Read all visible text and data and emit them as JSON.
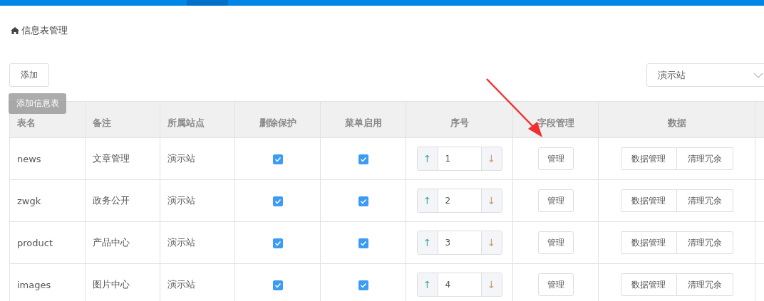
{
  "breadcrumb": {
    "title": "信息表管理"
  },
  "toolbar": {
    "add_button": "添加",
    "tooltip": "添加信息表",
    "site_select": {
      "value": "演示站"
    }
  },
  "table": {
    "columns": [
      "表名",
      "备注",
      "所属站点",
      "删除保护",
      "菜单启用",
      "序号",
      "字段管理",
      "数据"
    ],
    "rows": [
      {
        "name": "news",
        "note": "文章管理",
        "site": "演示站",
        "delete_protect": true,
        "menu_enabled": true,
        "order": "1",
        "up": "↑",
        "down": "↓",
        "field_button": "管理",
        "data_buttons": [
          "数据管理",
          "清理冗余"
        ]
      },
      {
        "name": "zwgk",
        "note": "政务公开",
        "site": "演示站",
        "delete_protect": true,
        "menu_enabled": true,
        "order": "2",
        "up": "↑",
        "down": "↓",
        "field_button": "管理",
        "data_buttons": [
          "数据管理",
          "清理冗余"
        ]
      },
      {
        "name": "product",
        "note": "产品中心",
        "site": "演示站",
        "delete_protect": true,
        "menu_enabled": true,
        "order": "3",
        "up": "↑",
        "down": "↓",
        "field_button": "管理",
        "data_buttons": [
          "数据管理",
          "清理冗余"
        ]
      },
      {
        "name": "images",
        "note": "图片中心",
        "site": "演示站",
        "delete_protect": true,
        "menu_enabled": true,
        "order": "4",
        "up": "↑",
        "down": "↓",
        "field_button": "管理",
        "data_buttons": [
          "数据管理",
          "清理冗余"
        ]
      }
    ]
  }
}
